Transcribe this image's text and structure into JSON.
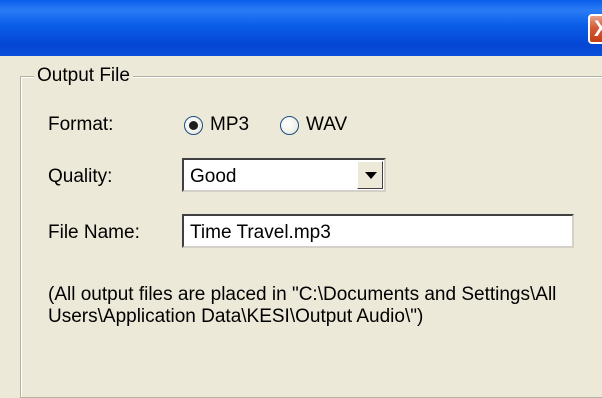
{
  "window": {
    "close_glyph": "X"
  },
  "output_file": {
    "group_label": "Output File",
    "format": {
      "label": "Format:",
      "options": [
        {
          "label": "MP3",
          "selected": true
        },
        {
          "label": "WAV",
          "selected": false
        }
      ]
    },
    "quality": {
      "label": "Quality:",
      "selected": "Good"
    },
    "file_name": {
      "label": "File Name:",
      "value": "Time Travel.mp3"
    },
    "note": "(All output files are placed in \"C:\\Documents and Settings\\All Users\\Application Data\\KESI\\Output Audio\\\")"
  },
  "colors": {
    "titlebar": "#0a5ee9",
    "dialog_bg": "#ece9d8",
    "close_button": "#d65a36"
  }
}
